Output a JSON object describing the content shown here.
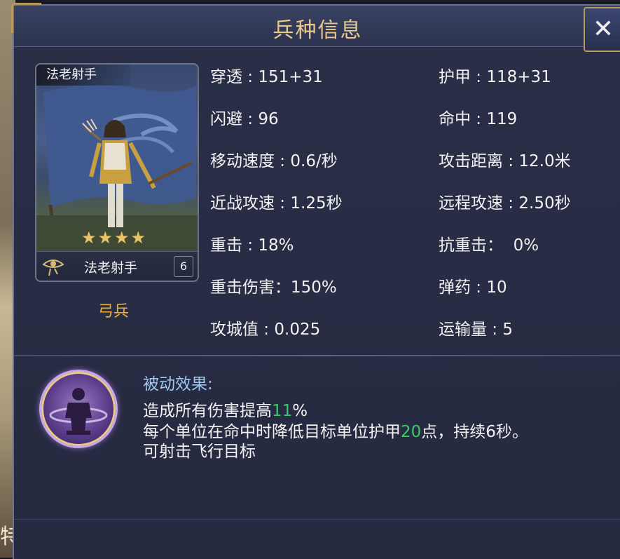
{
  "header": {
    "title": "兵种信息"
  },
  "close_label": "✕",
  "unit_card": {
    "name_top": "法老射手",
    "name_bottom": "法老射手",
    "level": "6",
    "star_rating": 4,
    "stars": [
      "★",
      "★",
      "★",
      "★"
    ]
  },
  "unit_type": "弓兵",
  "stats_left": [
    "穿透 : 151+31",
    "闪避 : 96",
    "移动速度 : 0.6/秒",
    "近战攻速 : 1.25秒",
    "重击 : 18%",
    "重击伤害：150%",
    "攻城值 : 0.025"
  ],
  "stats_right": [
    "护甲 : 118+31",
    "命中 : 119",
    "攻击距离 : 12.0米",
    "远程攻速 : 2.50秒",
    "抗重击：  0%",
    "弹药 : 10",
    "运输量 : 5"
  ],
  "passive": {
    "title": "被动效果:",
    "line1_pre": "造成所有伤害提高",
    "line1_hl": "11",
    "line1_post": "%",
    "line2_pre": "每个单位在命中时降低目标单位护甲",
    "line2_hl": "20",
    "line2_post": "点，持续6秒。",
    "line3": "可射击飞行目标"
  },
  "background_edge_char": "特",
  "colors": {
    "title": "#e8c98a",
    "unit_type": "#f0b030",
    "passive_title": "#9ec6f0",
    "highlight": "#3cc86a"
  }
}
